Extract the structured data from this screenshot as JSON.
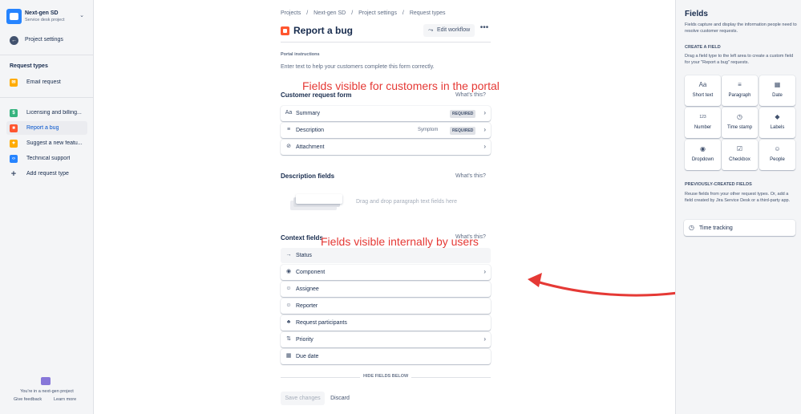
{
  "sidebar": {
    "project_name": "Next-gen SD",
    "project_type": "Service desk project",
    "back_label": "Project settings",
    "section_title": "Request types",
    "email_item": {
      "label": "Email request",
      "color": "#FFAB00"
    },
    "items": [
      {
        "label": "Licensing and billing...",
        "color": "#36B37E",
        "glyph": "$"
      },
      {
        "label": "Report a bug",
        "color": "#FF5630",
        "glyph": "■"
      },
      {
        "label": "Suggest a new featu...",
        "color": "#FFAB00",
        "glyph": "✦"
      },
      {
        "label": "Technical support",
        "color": "#2684FF",
        "glyph": "<>"
      }
    ],
    "add_label": "Add request type",
    "footer_text": "You're in a next-gen project",
    "give_feedback": "Give feedback",
    "learn_more": "Learn more"
  },
  "breadcrumbs": [
    "Projects",
    "/",
    "Next-gen SD",
    "/",
    "Project settings",
    "/",
    "Request types"
  ],
  "header": {
    "title": "Report a bug",
    "edit_workflow": "Edit workflow",
    "more": "•••"
  },
  "portal": {
    "label": "Portal instructions",
    "placeholder": "Enter text to help your customers complete this form correctly."
  },
  "customer_form": {
    "title": "Customer request form",
    "whats_this": "What's this?",
    "fields": [
      {
        "label": "Summary",
        "icon": "Aa",
        "sub": "",
        "required": "REQUIRED",
        "chevron": "›"
      },
      {
        "label": "Description",
        "icon": "≡",
        "sub": "Symptom",
        "required": "REQUIRED",
        "chevron": "›"
      },
      {
        "label": "Attachment",
        "icon": "⊘",
        "sub": "",
        "required": "",
        "chevron": "›"
      }
    ]
  },
  "description_fields": {
    "title": "Description fields",
    "whats_this": "What's this?",
    "drop_hint": "Drag and drop paragraph text fields here"
  },
  "context_fields": {
    "title": "Context fields",
    "whats_this": "What's this?",
    "fields": [
      {
        "label": "Status",
        "icon": "→",
        "chevron": "",
        "flat": true
      },
      {
        "label": "Component",
        "icon": "◉",
        "chevron": "›",
        "flat": false
      },
      {
        "label": "Assignee",
        "icon": "☺",
        "chevron": "",
        "flat": false
      },
      {
        "label": "Reporter",
        "icon": "☺",
        "chevron": "",
        "flat": false
      },
      {
        "label": "Request participants",
        "icon": "♣",
        "chevron": "",
        "flat": false
      },
      {
        "label": "Priority",
        "icon": "⇅",
        "chevron": "›",
        "flat": false
      },
      {
        "label": "Due date",
        "icon": "▦",
        "chevron": "",
        "flat": false
      }
    ],
    "hide_below": "HIDE FIELDS BELOW"
  },
  "actions": {
    "save": "Save changes",
    "discard": "Discard"
  },
  "annotations": {
    "top": "Fields visible for customers in the portal",
    "bottom": "Fields visible internally by users",
    "color": "#E53935"
  },
  "fields_panel": {
    "title": "Fields",
    "description": "Fields capture and display the information people need to resolve customer requests.",
    "create_title": "CREATE A FIELD",
    "create_desc": "Drag a field type to the left area to create a custom field for your \"Report a bug\" requests.",
    "types": [
      {
        "label": "Short text",
        "icon": "Aa"
      },
      {
        "label": "Paragraph",
        "icon": "≡"
      },
      {
        "label": "Date",
        "icon": "▦"
      },
      {
        "label": "Number",
        "icon": "123"
      },
      {
        "label": "Time stamp",
        "icon": "◷"
      },
      {
        "label": "Labels",
        "icon": "◆"
      },
      {
        "label": "Dropdown",
        "icon": "◉"
      },
      {
        "label": "Checkbox",
        "icon": "☑"
      },
      {
        "label": "People",
        "icon": "☺"
      }
    ],
    "previous_title": "PREVIOUSLY-CREATED FIELDS",
    "previous_desc": "Reuse fields from your other request types. Or, add a field created by Jira Service Desk or a third-party app.",
    "time_tracking": "Time tracking"
  }
}
